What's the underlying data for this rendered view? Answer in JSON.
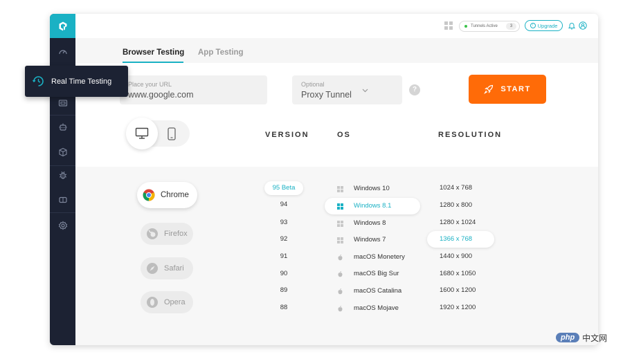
{
  "header": {
    "tunnels_label": "Tunnels Active",
    "tunnels_count": "3",
    "upgrade_label": "Upgrade"
  },
  "tabs": [
    {
      "label": "Browser Testing",
      "active": true
    },
    {
      "label": "App Testing",
      "active": false
    }
  ],
  "url_input": {
    "placeholder": "Place your URL",
    "value": "www.google.com"
  },
  "proxy_select": {
    "placeholder": "Optional",
    "value": "Proxy Tunnel"
  },
  "help_label": "?",
  "start_label": "START",
  "column_headers": {
    "version": "VERSION",
    "os": "OS",
    "resolution": "RESOLUTION"
  },
  "browsers": [
    {
      "name": "Chrome",
      "selected": true
    },
    {
      "name": "Firefox",
      "selected": false
    },
    {
      "name": "Safari",
      "selected": false
    },
    {
      "name": "Opera",
      "selected": false
    }
  ],
  "versions": [
    {
      "label": "95 Beta",
      "selected": true
    },
    {
      "label": "94",
      "selected": false
    },
    {
      "label": "93",
      "selected": false
    },
    {
      "label": "92",
      "selected": false
    },
    {
      "label": "91",
      "selected": false
    },
    {
      "label": "90",
      "selected": false
    },
    {
      "label": "89",
      "selected": false
    },
    {
      "label": "88",
      "selected": false
    }
  ],
  "os_list": [
    {
      "label": "Windows 10",
      "icon": "windows-icon",
      "selected": false
    },
    {
      "label": "Windows 8.1",
      "icon": "windows-icon",
      "selected": true
    },
    {
      "label": "Windows 8",
      "icon": "windows-icon",
      "selected": false
    },
    {
      "label": "Windows 7",
      "icon": "windows-icon",
      "selected": false
    },
    {
      "label": "macOS Monetery",
      "icon": "apple-icon",
      "selected": false
    },
    {
      "label": "macOS Big Sur",
      "icon": "apple-icon",
      "selected": false
    },
    {
      "label": "macOS Catalina",
      "icon": "apple-icon",
      "selected": false
    },
    {
      "label": "macOS Mojave",
      "icon": "apple-icon",
      "selected": false
    }
  ],
  "resolutions": [
    {
      "label": "1024 x 768",
      "selected": false
    },
    {
      "label": "1280 x 800",
      "selected": false
    },
    {
      "label": "1280 x 1024",
      "selected": false
    },
    {
      "label": "1366 x 768",
      "selected": true
    },
    {
      "label": "1440 x 900",
      "selected": false
    },
    {
      "label": "1680 x 1050",
      "selected": false
    },
    {
      "label": "1600 x 1200",
      "selected": false
    },
    {
      "label": "1920 x 1200",
      "selected": false
    }
  ],
  "tooltip": {
    "label": "Real Time Testing",
    "icon": "realtime-clock-icon"
  },
  "watermark": {
    "brand": "php",
    "text": "中文网"
  },
  "colors": {
    "accent": "#1ab1c4",
    "start": "#ff6b08",
    "sidebar": "#1c2233"
  }
}
